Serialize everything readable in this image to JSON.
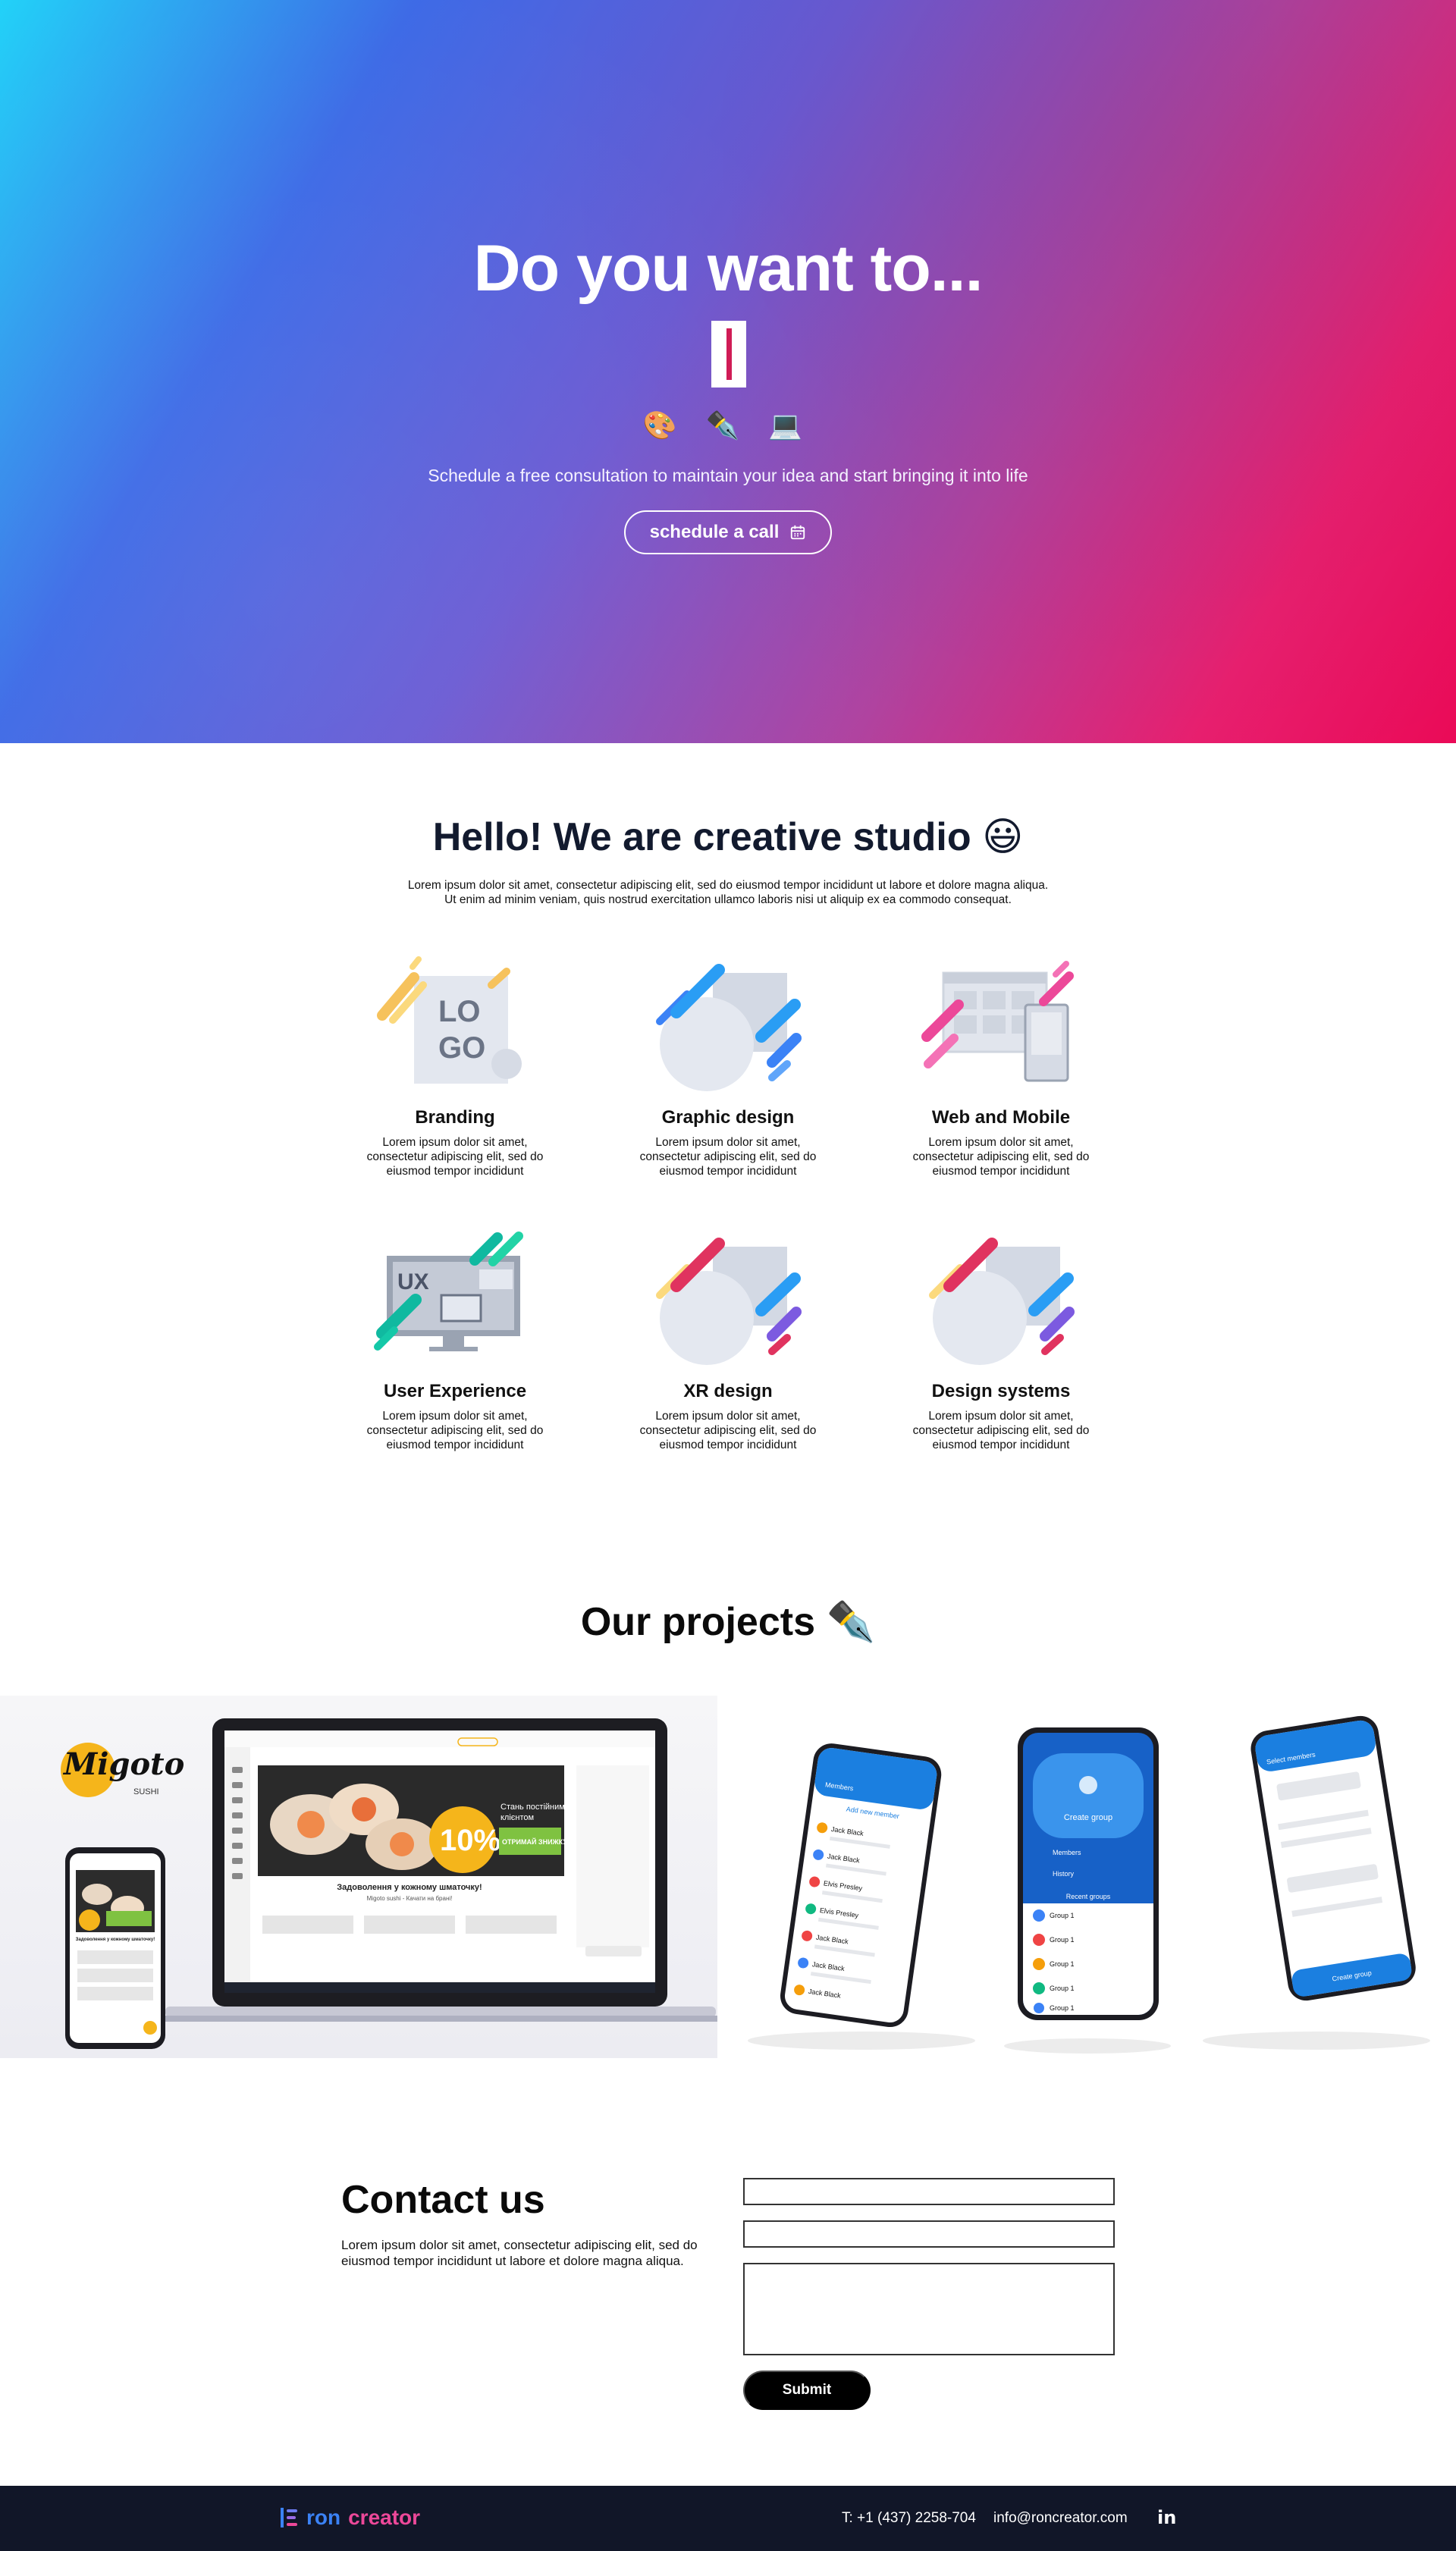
{
  "hero": {
    "title": "Do you want to...",
    "emojis": "🎨 ✒️ 💻",
    "subtitle": "Schedule a free consultation to maintain your idea and start bringing it into life",
    "cta_label": "schedule a call"
  },
  "about": {
    "title": "Hello! We are creative studio 😃",
    "text_line1": "Lorem ipsum dolor sit amet, consectetur adipiscing elit, sed do eiusmod tempor incididunt ut labore et dolore magna aliqua.",
    "text_line2": "Ut enim ad minim veniam, quis nostrud exercitation ullamco laboris nisi ut aliquip ex ea commodo consequat."
  },
  "services": [
    {
      "title": "Branding",
      "text": "Lorem ipsum dolor sit amet, consectetur adipiscing elit, sed do eiusmod tempor incididunt",
      "icon": "logo-illustration",
      "logo_text": "LO GO"
    },
    {
      "title": "Graphic design",
      "text": "Lorem ipsum dolor sit amet, consectetur adipiscing elit, sed do eiusmod tempor incididunt",
      "icon": "shapes-illustration"
    },
    {
      "title": "Web and Mobile",
      "text": "Lorem ipsum dolor sit amet, consectetur adipiscing elit, sed do eiusmod tempor incididunt",
      "icon": "web-mobile-illustration"
    },
    {
      "title": "User Experience",
      "text": "Lorem ipsum dolor sit amet, consectetur adipiscing elit, sed do eiusmod tempor incididunt",
      "icon": "ux-illustration",
      "ux_text": "UX"
    },
    {
      "title": "XR design",
      "text": "Lorem ipsum dolor sit amet, consectetur adipiscing elit, sed do eiusmod tempor incididunt",
      "icon": "shapes-illustration"
    },
    {
      "title": "Design systems",
      "text": "Lorem ipsum dolor sit amet, consectetur adipiscing elit, sed do eiusmod tempor incididunt",
      "icon": "shapes-illustration"
    }
  ],
  "projects": {
    "title": "Our projects ✒️",
    "left": {
      "brand": "Migoto",
      "brand_sub": "SUSHI",
      "promo_badge": "10%",
      "promo_line1": "Стань постійним",
      "promo_line2": "клієнтом",
      "promo_green": "ОТРИМАЙ ЗНИЖКУ",
      "tagline": "Задоволення у кожному шматочку!",
      "tagline_sub": "Migoto sushi - Качати на брані!",
      "phone_tagline": "Задоволення у кожному шматочку!"
    },
    "right": {
      "phone1_header": "Members",
      "phone1_action": "Add new member",
      "phone1_members": [
        "Jack Black",
        "Jack Black",
        "Elvis Presley",
        "Elvis Presley",
        "Jack Black",
        "Jack Black",
        "Jack Black"
      ],
      "phone2_header": "Create group",
      "phone2_items": [
        "Members",
        "History"
      ],
      "phone2_recent": "Recent groups",
      "phone2_groups": [
        "Group 1",
        "Group 1",
        "Group 1",
        "Group 1",
        "Group 1"
      ],
      "phone3_header": "Select members",
      "phone3_button": "Create group"
    }
  },
  "contact": {
    "title": "Contact us",
    "text": "Lorem ipsum dolor sit amet, consectetur adipiscing elit, sed do eiusmod tempor incididunt ut labore et dolore magna aliqua.",
    "name_placeholder": "",
    "email_placeholder": "",
    "message_placeholder": "",
    "submit_label": "Submit"
  },
  "footer": {
    "brand_ron": "ron",
    "brand_creator": "creator",
    "phone": "T: +1 (437) 2258-704",
    "email": "info@roncreator.com",
    "linkedin": "in"
  },
  "colors": {
    "hero_cyan": "#22d2f8",
    "hero_purple": "#6a5ad3",
    "hero_pink": "#ea0a57",
    "footer_bg": "#111628",
    "brand_blue": "#3b82f6",
    "brand_pink": "#ec4899"
  }
}
